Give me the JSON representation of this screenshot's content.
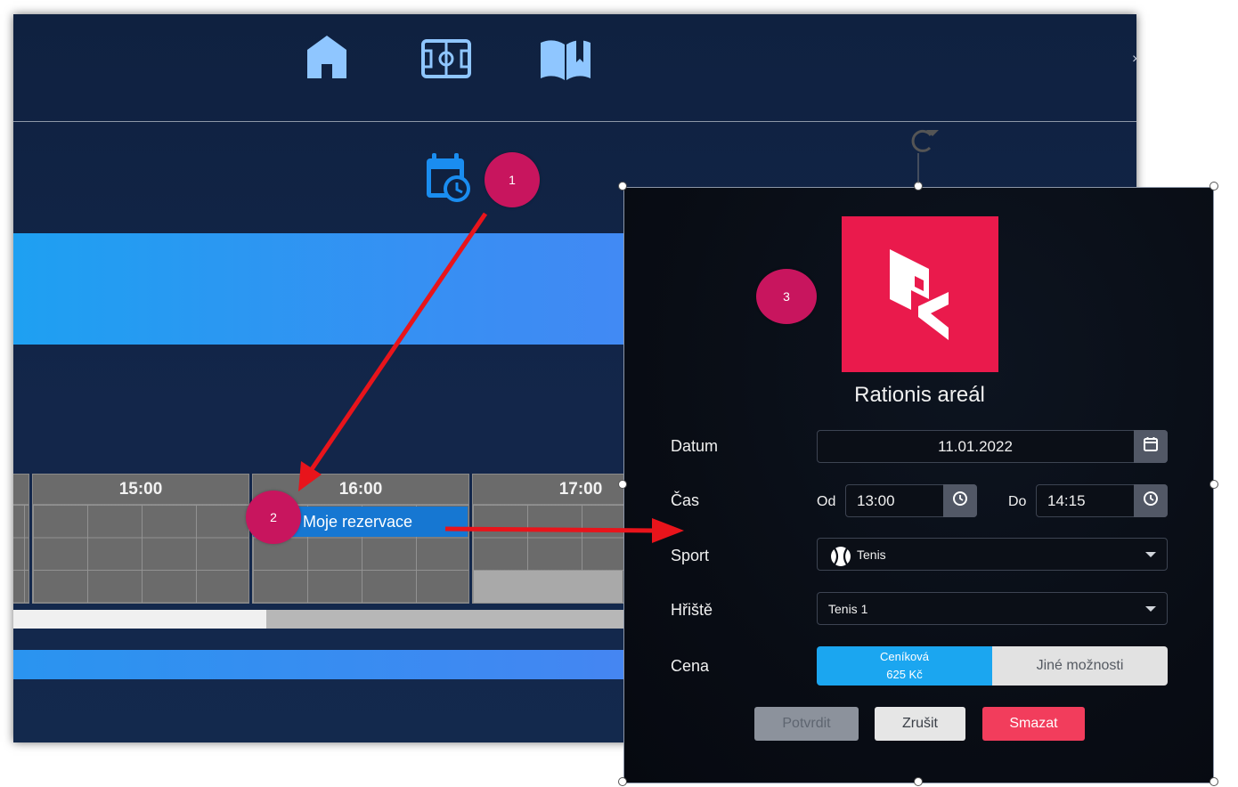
{
  "app": {
    "nav_icons": [
      "home-icon",
      "field-icon",
      "book-icon"
    ],
    "timeline": {
      "hours": [
        "15:00",
        "16:00",
        "17:00"
      ],
      "reservation_label": "Moje rezervace"
    }
  },
  "callouts": [
    "1",
    "2",
    "3"
  ],
  "modal": {
    "venue_name": "Rationis areál",
    "date": {
      "label": "Datum",
      "value": "11.01.2022"
    },
    "time": {
      "label": "Čas",
      "from_label": "Od",
      "from_value": "13:00",
      "to_label": "Do",
      "to_value": "14:15"
    },
    "sport": {
      "label": "Sport",
      "value": "Tenis"
    },
    "court": {
      "label": "Hřiště",
      "value": "Tenis 1"
    },
    "price": {
      "label": "Cena",
      "option_a_title": "Ceníková",
      "option_a_price": "625 Kč",
      "option_b": "Jiné možnosti"
    },
    "buttons": {
      "confirm": "Potvrdit",
      "cancel": "Zrušit",
      "delete": "Smazat"
    }
  },
  "colors": {
    "accent": "#1ba6f0",
    "brand": "#ea1a4c",
    "callout": "#c8155e",
    "delete": "#f23d5c",
    "arrow": "#e8141b"
  }
}
